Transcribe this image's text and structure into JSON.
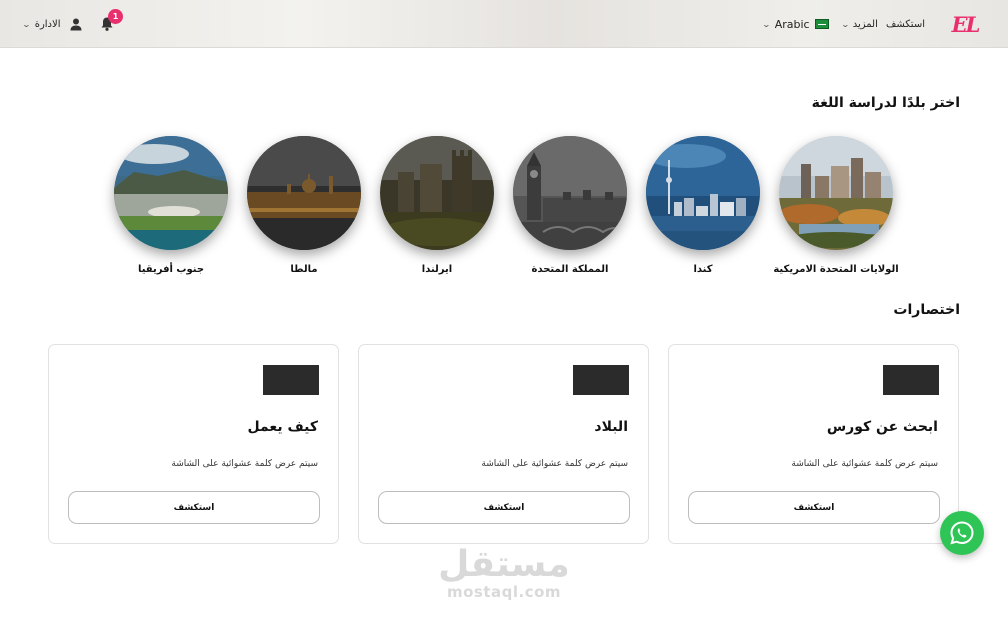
{
  "navbar": {
    "logo_text": "EL",
    "links": [
      "استكشف",
      "المزيد"
    ],
    "language": "Arabic",
    "notification_count": "1",
    "admin_label": "الادارة"
  },
  "countries_section": {
    "title": "اختر بلدًا لدراسة اللغة",
    "countries": [
      {
        "name": "الولايات المتحدة الامريكية"
      },
      {
        "name": "كندا"
      },
      {
        "name": "المملكة المتحدة"
      },
      {
        "name": "ايرلندا"
      },
      {
        "name": "مالطا"
      },
      {
        "name": "جنوب أفريقيا"
      }
    ]
  },
  "shortcuts_section": {
    "title": "اختصارات",
    "cards": [
      {
        "title": "ابحث عن كورس",
        "description": "سيتم عرض كلمة عشوائية على الشاشة",
        "button": "استكشف"
      },
      {
        "title": "البلاد",
        "description": "سيتم عرض كلمة عشوائية على الشاشة",
        "button": "استكشف"
      },
      {
        "title": "كيف يعمل",
        "description": "سيتم عرض كلمة عشوائية على الشاشة",
        "button": "استكشف"
      }
    ]
  },
  "watermark": {
    "arabic": "مستقل",
    "latin": "mostaql.com"
  },
  "colors": {
    "brand": "#e8306e",
    "whatsapp": "#2fc556",
    "card_border": "#e1e1e1"
  }
}
